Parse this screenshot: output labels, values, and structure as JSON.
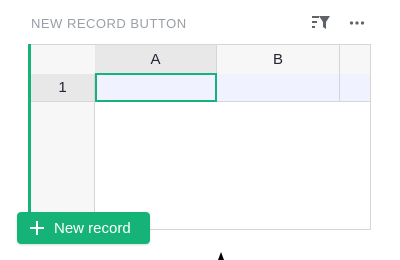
{
  "widget": {
    "title": "NEW RECORD BUTTON",
    "filter_icon": "filter-sort-icon",
    "more_icon": "more-horizontal-icon"
  },
  "grid": {
    "columns": [
      "A",
      "B",
      ""
    ],
    "rows": [
      {
        "number": "1",
        "cells": [
          "",
          "",
          ""
        ]
      }
    ],
    "selected_cell": "A1"
  },
  "button": {
    "label": "New record",
    "icon": "plus-icon"
  },
  "colors": {
    "accent": "#16b378",
    "title_text": "#9aa0a6",
    "selected_cell_fill": "#f0f3ff"
  }
}
